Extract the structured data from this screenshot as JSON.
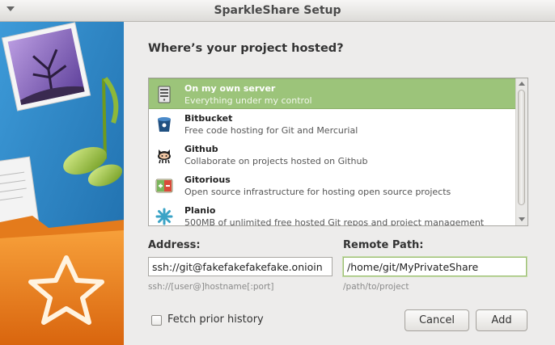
{
  "window": {
    "title": "SparkleShare Setup"
  },
  "heading": "Where’s your project hosted?",
  "hosts": [
    {
      "name": "On my own server",
      "description": "Everything under my control",
      "icon": "server-icon",
      "selected": true
    },
    {
      "name": "Bitbucket",
      "description": "Free code hosting for Git and Mercurial",
      "icon": "bitbucket-icon",
      "selected": false
    },
    {
      "name": "Github",
      "description": "Collaborate on projects hosted on Github",
      "icon": "github-octocat-icon",
      "selected": false
    },
    {
      "name": "Gitorious",
      "description": "Open source infrastructure for hosting open source projects",
      "icon": "gitorious-icon",
      "selected": false
    },
    {
      "name": "Planio",
      "description": "500MB of unlimited free hosted Git repos and project management",
      "icon": "planio-icon",
      "selected": false
    }
  ],
  "address": {
    "label": "Address:",
    "value": "ssh://git@fakefakefakefake.onioin",
    "hint": "ssh://[user@]hostname[:port]"
  },
  "remote_path": {
    "label": "Remote Path:",
    "value": "/home/git/MyPrivateShare",
    "hint": "/path/to/project"
  },
  "fetch_history": {
    "label": "Fetch prior history",
    "checked": false
  },
  "buttons": {
    "cancel": "Cancel",
    "add": "Add"
  },
  "colors": {
    "selection": "#9cc47a",
    "side_blue": "#2a86c8",
    "folder_orange": "#f08a24"
  }
}
